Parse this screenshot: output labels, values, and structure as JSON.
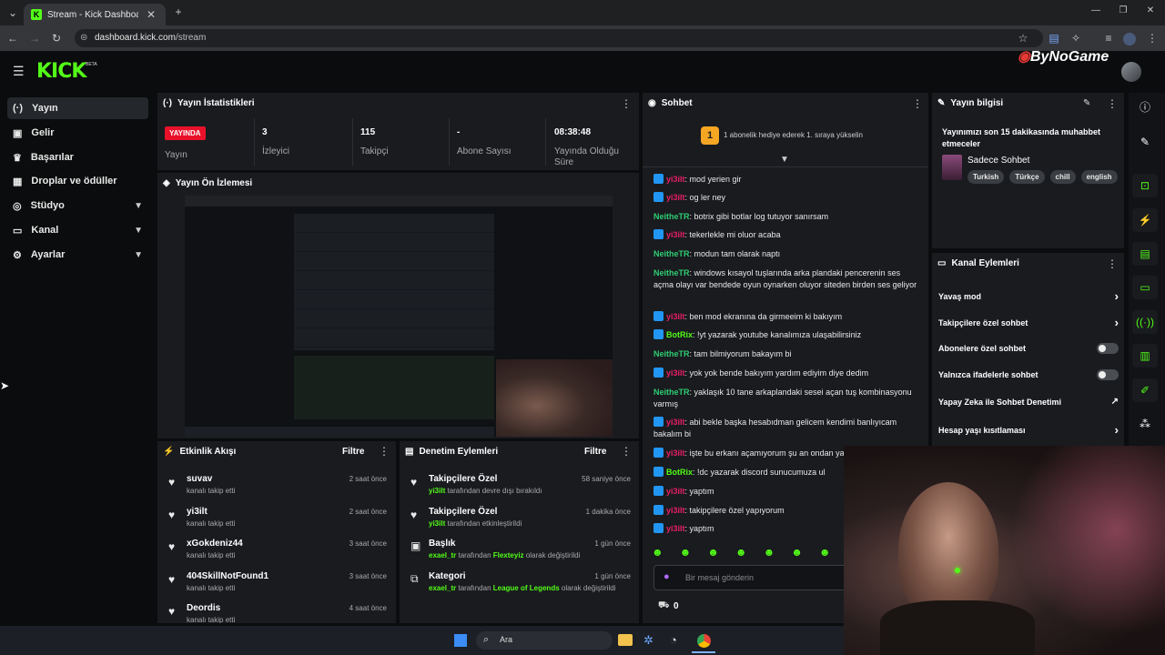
{
  "browser": {
    "tab_title": "Stream - Kick Dashboard",
    "url_host": "dashboard.kick.com",
    "url_path": "/stream"
  },
  "header": {
    "logo": "KICK",
    "beta": "BETA",
    "watermark": "ByNoGame"
  },
  "sidebar": {
    "items": [
      {
        "label": "Yayın",
        "icon": "broadcast-icon"
      },
      {
        "label": "Gelir",
        "icon": "revenue-icon"
      },
      {
        "label": "Başarılar",
        "icon": "trophy-icon"
      },
      {
        "label": "Droplar ve ödüller",
        "icon": "gift-icon"
      },
      {
        "label": "Stüdyo",
        "icon": "studio-icon"
      },
      {
        "label": "Kanal",
        "icon": "channel-icon"
      },
      {
        "label": "Ayarlar",
        "icon": "gear-icon"
      }
    ]
  },
  "stats": {
    "title": "Yayın İstatistikleri",
    "live_badge": "YAYINDA",
    "live_label": "Yayın",
    "viewers": "3",
    "viewers_label": "İzleyici",
    "followers": "115",
    "followers_label": "Takipçi",
    "subs": "-",
    "subs_label": "Abone Sayısı",
    "uptime": "08:38:48",
    "uptime_label": "Yayında Olduğu Süre"
  },
  "preview": {
    "title": "Yayın Ön İzlemesi"
  },
  "activity": {
    "title": "Etkinlik Akışı",
    "filter": "Filtre",
    "items": [
      {
        "name": "suvav",
        "sub": "kanalı takip etti",
        "time": "2 saat önce"
      },
      {
        "name": "yi3ilt",
        "sub": "kanalı takip etti",
        "time": "2 saat önce"
      },
      {
        "name": "xGokdeniz44",
        "sub": "kanalı takip etti",
        "time": "3 saat önce"
      },
      {
        "name": "404SkillNotFound1",
        "sub": "kanalı takip etti",
        "time": "3 saat önce"
      },
      {
        "name": "Deordis",
        "sub": "kanalı takip etti",
        "time": "4 saat önce"
      }
    ]
  },
  "moderation": {
    "title": "Denetim Eylemleri",
    "filter": "Filtre",
    "items": [
      {
        "title": "Takipçilere Özel",
        "actor": "yi3ilt",
        "text": "tarafından devre dışı bırakıldı",
        "extra": "",
        "tail": "",
        "time": "58 saniye önce"
      },
      {
        "title": "Takipçilere Özel",
        "actor": "yi3ilt",
        "text": "tarafından etkinleştirildi",
        "extra": "",
        "tail": "",
        "time": "1 dakika önce"
      },
      {
        "title": "Başlık",
        "actor": "exael_tr",
        "text": "tarafından",
        "extra": "Flexteyiz",
        "tail": "olarak değiştirildi",
        "time": "1 gün önce"
      },
      {
        "title": "Kategori",
        "actor": "exael_tr",
        "text": "tarafından",
        "extra": "League of Legends",
        "tail": "olarak değiştirildi",
        "time": "1 gün önce"
      }
    ]
  },
  "chat": {
    "title": "Sohbet",
    "promo": "1 abonelik hediye ederek 1. sıraya yükselin",
    "promo_rank": "1",
    "messages": [
      {
        "user": "yi3ilt",
        "color": "#e91e63",
        "badge": true,
        "text": "mod yerien gir"
      },
      {
        "user": "yi3ilt",
        "color": "#e91e63",
        "badge": true,
        "text": "og ler ney"
      },
      {
        "user": "NeitheTR",
        "color": "#2ecc71",
        "badge": false,
        "text": "botrix gibi botlar log tutuyor sanırsam"
      },
      {
        "user": "yi3ilt",
        "color": "#e91e63",
        "badge": true,
        "text": "tekerlekle mi oluor acaba"
      },
      {
        "user": "NeitheTR",
        "color": "#2ecc71",
        "badge": false,
        "text": "modun tam olarak naptı"
      },
      {
        "user": "NeitheTR",
        "color": "#2ecc71",
        "badge": false,
        "text": "windows kısayol tuşlarında arka plandaki pencerenin ses açma olayı var bendede oyun oynarken oluyor siteden birden ses geliyor"
      },
      {
        "user": "yi3ilt",
        "color": "#e91e63",
        "badge": true,
        "text": "ben mod ekranına da girmeeim ki bakıyım"
      },
      {
        "user": "BotRix",
        "color": "#53fc18",
        "badge": true,
        "text": "!yt yazarak youtube kanalımıza ulaşabilirsiniz"
      },
      {
        "user": "NeitheTR",
        "color": "#2ecc71",
        "badge": false,
        "text": "tam bilmiyorum bakayım bi"
      },
      {
        "user": "yi3ilt",
        "color": "#e91e63",
        "badge": true,
        "text": "yok yok bende bakıyım yardım ediyim diye dedim"
      },
      {
        "user": "NeitheTR",
        "color": "#2ecc71",
        "badge": false,
        "text": "yaklaşık 10 tane arkaplandaki sesei açan tuş kombinasyonu varmış"
      },
      {
        "user": "yi3ilt",
        "color": "#e91e63",
        "badge": true,
        "text": "abi bekle başka hesabıdman gelicem kendimi banlıyıcam bakalım bi"
      },
      {
        "user": "yi3ilt",
        "color": "#e91e63",
        "badge": true,
        "text": "işte bu erkanı açamıyorum şu an ondan ya"
      },
      {
        "user": "BotRix",
        "color": "#53fc18",
        "badge": true,
        "text": "!dc yazarak discord sunucumuza ul"
      },
      {
        "user": "yi3ilt",
        "color": "#e91e63",
        "badge": true,
        "text": "yaptım"
      },
      {
        "user": "yi3ilt",
        "color": "#e91e63",
        "badge": true,
        "text": "takipçilere özel yapıyorum"
      },
      {
        "user": "yi3ilt",
        "color": "#e91e63",
        "badge": true,
        "text": "yaptım"
      }
    ],
    "input_placeholder": "Bir mesaj gönderin",
    "points": "0"
  },
  "stream_info": {
    "title": "Yayın bilgisi",
    "stream_title": "Yayınımızı son 15 dakikasında muhabbet etmeceler",
    "category": "Sadece Sohbet",
    "tags": [
      "Turkish",
      "Türkçe",
      "chill",
      "english"
    ]
  },
  "channel_actions": {
    "title": "Kanal Eylemleri",
    "items": [
      {
        "label": "Yavaş mod",
        "control": "chevron"
      },
      {
        "label": "Takipçilere özel sohbet",
        "control": "chevron"
      },
      {
        "label": "Abonelere özel sohbet",
        "control": "toggle"
      },
      {
        "label": "Yalnızca ifadelerle sohbet",
        "control": "toggle"
      },
      {
        "label": "Yapay Zeka ile Sohbet Denetimi",
        "control": "external"
      },
      {
        "label": "Hesap yaşı kısıtlaması",
        "control": "chevron"
      }
    ]
  },
  "taskbar": {
    "search": "Ara"
  },
  "colors": {
    "accent": "#53fc18",
    "live": "#e9112a",
    "panel": "#191b1f",
    "bg": "#0b0c0d"
  }
}
